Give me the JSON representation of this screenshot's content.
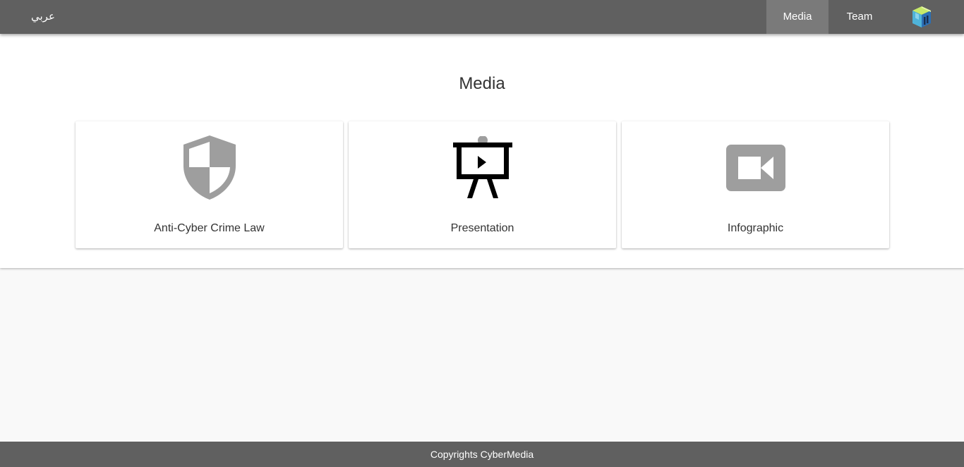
{
  "nav": {
    "language_link": "عربي",
    "items": [
      {
        "label": "Media",
        "active": true
      },
      {
        "label": "Team",
        "active": false
      }
    ],
    "logo_icon": "cybermedia-cube-logo-icon"
  },
  "main": {
    "title": "Media",
    "cards": [
      {
        "label": "Anti-Cyber Crime Law",
        "icon": "shield-icon"
      },
      {
        "label": "Presentation",
        "icon": "presentation-easel-icon"
      },
      {
        "label": "Infographic",
        "icon": "video-camera-icon"
      }
    ]
  },
  "footer": {
    "text": "Copyrights CyberMedia"
  },
  "colors": {
    "navbar": "#606060",
    "nav_active": "#7a7a7a",
    "icon_gray": "#9e9e9e",
    "page_background": "#f9f9f9"
  }
}
